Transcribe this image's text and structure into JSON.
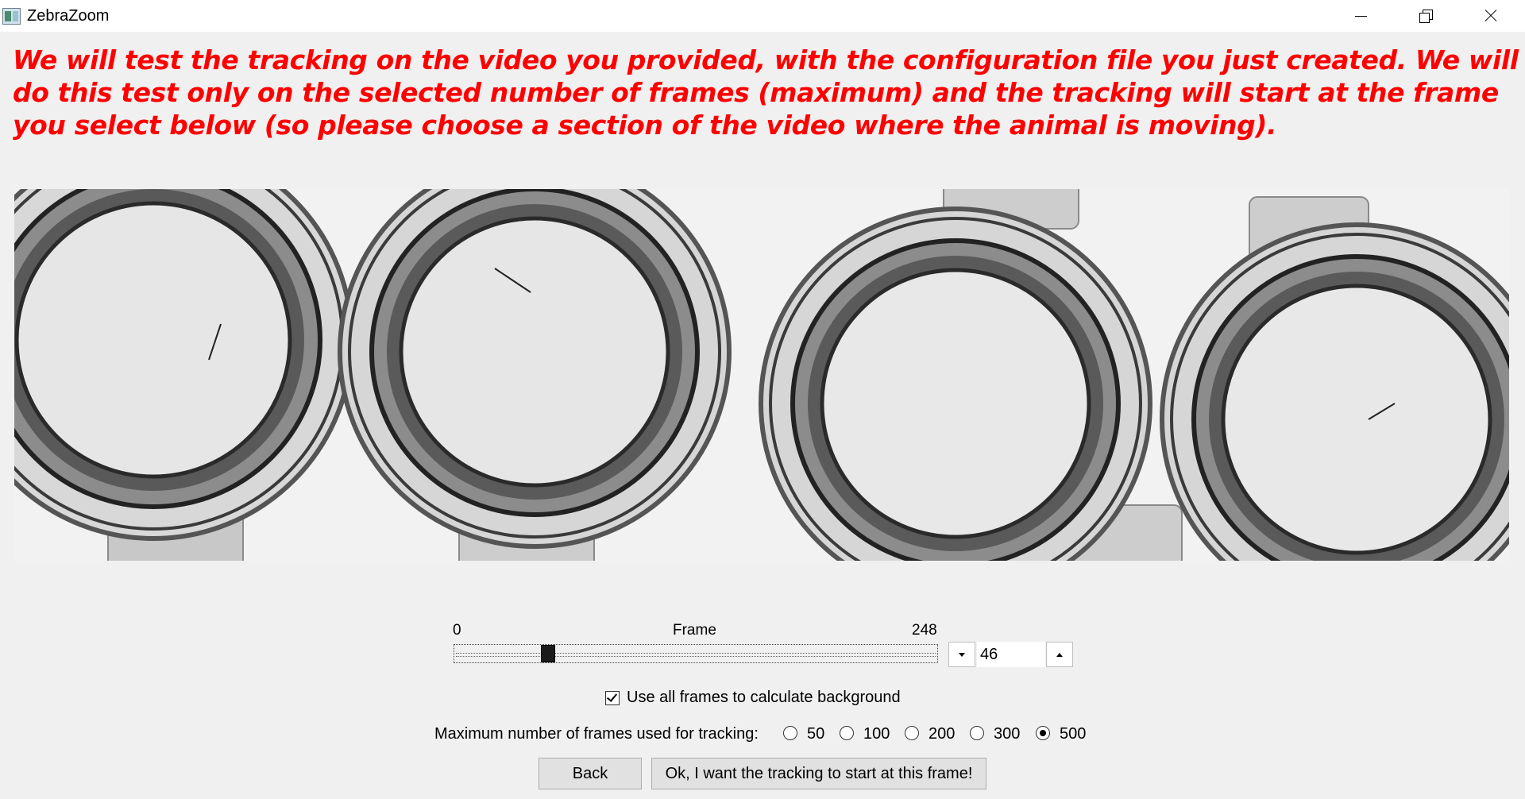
{
  "window": {
    "title": "ZebraZoom"
  },
  "instruction": {
    "text": "We will test the tracking on the video you provided, with the configuration file you just created. We will do this test only on the selected number of frames (maximum) and the tracking will start at the frame you select below (so please choose a section of the video where the animal is moving).",
    "color": "#ff0000"
  },
  "frame_slider": {
    "min_label": "0",
    "title": "Frame",
    "max_label": "248",
    "min": 0,
    "max": 248,
    "value": "46"
  },
  "background_checkbox": {
    "label": "Use all frames to calculate background",
    "checked": true
  },
  "max_frames": {
    "caption": "Maximum number of frames used for tracking:",
    "options": [
      "50",
      "100",
      "200",
      "300",
      "500"
    ],
    "selected": "500"
  },
  "buttons": {
    "back": "Back",
    "ok": "Ok, I want the tracking to start at this frame!"
  },
  "icons": {
    "app": "zebrazoom-app-icon",
    "minimize": "minimize-icon",
    "restore": "restore-icon",
    "close": "close-icon",
    "spin_down": "arrow-down-icon",
    "spin_up": "arrow-up-icon"
  }
}
